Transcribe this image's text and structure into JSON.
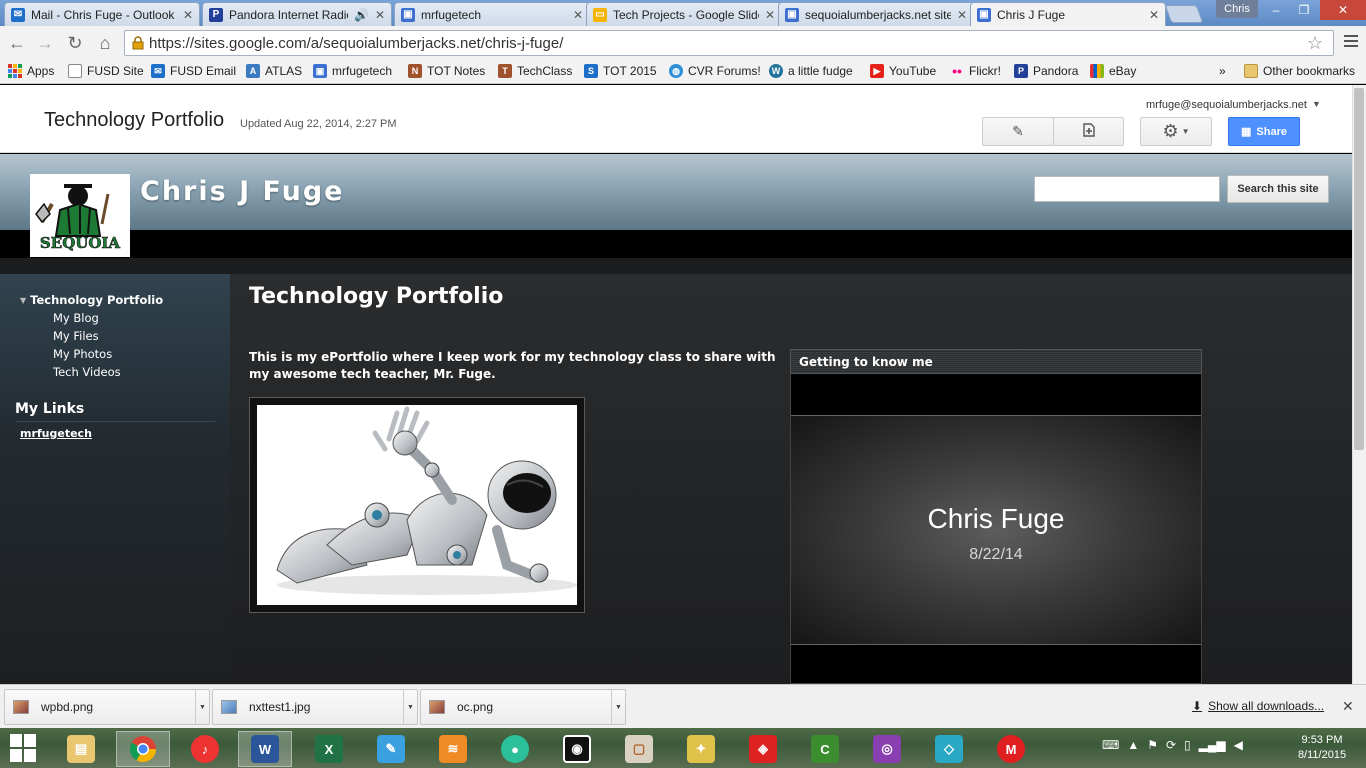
{
  "browser": {
    "tabs": [
      {
        "label": "Mail - Chris Fuge - Outlook",
        "icon": "outlook-icon",
        "color": "#1e6fc9"
      },
      {
        "label": "Pandora Internet Radio",
        "icon": "pandora-icon",
        "color": "#224099"
      },
      {
        "label": "mrfugetech",
        "icon": "sites-icon",
        "color": "#3b6fd1"
      },
      {
        "label": "Tech Projects - Google Slides",
        "icon": "slides-icon",
        "color": "#f4b400"
      },
      {
        "label": "sequoialumberjacks.net sites",
        "icon": "sites-icon",
        "color": "#3b6fd1"
      },
      {
        "label": "Chris J Fuge",
        "icon": "sites-icon",
        "color": "#3b6fd1"
      }
    ],
    "user": "Chris",
    "url": "https://sites.google.com/a/sequoialumberjacks.net/chris-j-fuge/",
    "bookmarks": [
      {
        "label": "Apps",
        "icon": "apps-grid-icon",
        "color": "#d93025"
      },
      {
        "label": "FUSD Site",
        "icon": "page-icon",
        "color": "#888888"
      },
      {
        "label": "FUSD Email",
        "icon": "mail-icon",
        "color": "#1e6fc9"
      },
      {
        "label": "ATLAS",
        "icon": "atlas-icon",
        "color": "#3b7bbf"
      },
      {
        "label": "mrfugetech",
        "icon": "sites-icon",
        "color": "#3b6fd1"
      },
      {
        "label": "TOT Notes",
        "icon": "notes-icon",
        "color": "#a0522d"
      },
      {
        "label": "TechClass",
        "icon": "class-icon",
        "color": "#a0522d"
      },
      {
        "label": "TOT 2015",
        "icon": "tot-icon",
        "color": "#1e6fc9"
      },
      {
        "label": "CVR Forums!",
        "icon": "globe-icon",
        "color": "#2f8fd8"
      },
      {
        "label": "a little fudge",
        "icon": "wordpress-icon",
        "color": "#21759b"
      },
      {
        "label": "YouTube",
        "icon": "youtube-icon",
        "color": "#e62117"
      },
      {
        "label": "Flickr!",
        "icon": "flickr-icon",
        "color": "#ff0084"
      },
      {
        "label": "Pandora",
        "icon": "pandora-icon",
        "color": "#224099"
      },
      {
        "label": "eBay",
        "icon": "ebay-icon",
        "color": "#e53238"
      }
    ],
    "overflow": "»",
    "other_bookmarks": "Other bookmarks"
  },
  "sites_header": {
    "title": "Technology Portfolio",
    "updated": "Updated Aug 22, 2014, 2:27 PM",
    "email": "mrfuge@sequoialumberjacks.net",
    "share_label": "Share",
    "accent": "#4d90fe"
  },
  "site": {
    "name": "Chris J Fuge",
    "logo_text": "SEQUOIA",
    "search_button": "Search this site",
    "nav": {
      "top": "Technology Portfolio",
      "items": [
        "My Blog",
        "My Files",
        "My Photos",
        "Tech Videos"
      ]
    },
    "links_heading": "My Links",
    "links": [
      "mrfugetech"
    ]
  },
  "page": {
    "title": "Technology Portfolio",
    "intro": "This is my ePortfolio where I keep work for my technology class to share with my awesome tech teacher, Mr. Fuge.",
    "gadget_title": "Getting to know me",
    "slide_name": "Chris Fuge",
    "slide_date": "8/22/14"
  },
  "downloads": {
    "files": [
      "wpbd.png",
      "nxttest1.jpg",
      "oc.png"
    ],
    "show_all": "Show all downloads..."
  },
  "taskbar": {
    "time": "9:53 PM",
    "date": "8/11/2015"
  }
}
